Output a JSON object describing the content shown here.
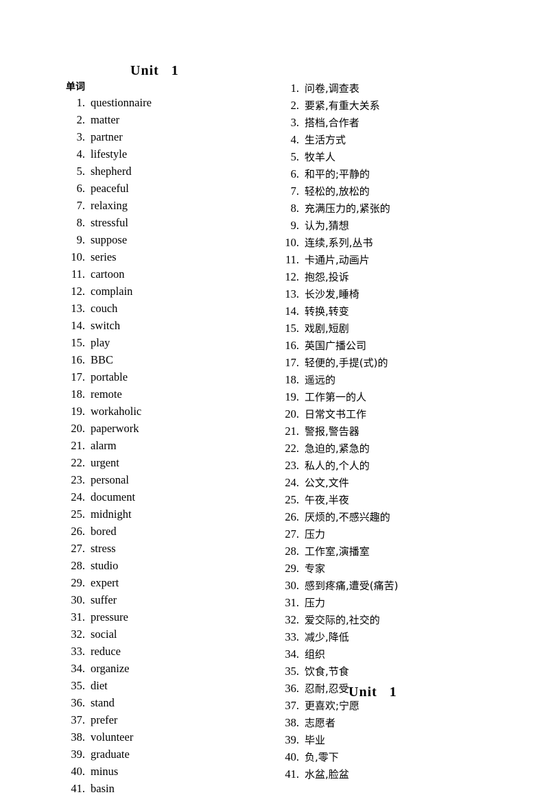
{
  "document": {
    "title_word": "Unit",
    "title_number": "1",
    "section_label": "单词",
    "footer_word": "Unit",
    "footer_number": "1"
  },
  "english_words": [
    {
      "idx": "1.",
      "text": "questionnaire"
    },
    {
      "idx": "2.",
      "text": "matter"
    },
    {
      "idx": "3.",
      "text": "partner"
    },
    {
      "idx": "4.",
      "text": "lifestyle"
    },
    {
      "idx": "5.",
      "text": "shepherd"
    },
    {
      "idx": "6.",
      "text": "peaceful"
    },
    {
      "idx": "7.",
      "text": "relaxing"
    },
    {
      "idx": "8.",
      "text": "stressful"
    },
    {
      "idx": "9.",
      "text": "suppose"
    },
    {
      "idx": "10.",
      "text": "series"
    },
    {
      "idx": "11.",
      "text": "cartoon"
    },
    {
      "idx": "12.",
      "text": "complain"
    },
    {
      "idx": "13.",
      "text": "couch"
    },
    {
      "idx": "14.",
      "text": "switch"
    },
    {
      "idx": "15.",
      "text": "play"
    },
    {
      "idx": "16.",
      "text": "BBC"
    },
    {
      "idx": "17.",
      "text": "portable"
    },
    {
      "idx": "18.",
      "text": "remote"
    },
    {
      "idx": "19.",
      "text": "workaholic"
    },
    {
      "idx": "20.",
      "text": "paperwork"
    },
    {
      "idx": "21.",
      "text": "alarm"
    },
    {
      "idx": "22.",
      "text": "urgent"
    },
    {
      "idx": "23.",
      "text": "personal"
    },
    {
      "idx": "24.",
      "text": "document"
    },
    {
      "idx": "25.",
      "text": "midnight"
    },
    {
      "idx": "26.",
      "text": "bored"
    },
    {
      "idx": "27.",
      "text": "stress"
    },
    {
      "idx": "28.",
      "text": "studio"
    },
    {
      "idx": "29.",
      "text": "expert"
    },
    {
      "idx": "30.",
      "text": "suffer"
    },
    {
      "idx": "31.",
      "text": "pressure"
    },
    {
      "idx": "32.",
      "text": "social"
    },
    {
      "idx": "33.",
      "text": "reduce"
    },
    {
      "idx": "34.",
      "text": "organize"
    },
    {
      "idx": "35.",
      "text": "diet"
    },
    {
      "idx": "36.",
      "text": "stand"
    },
    {
      "idx": "37.",
      "text": "prefer"
    },
    {
      "idx": "38.",
      "text": "volunteer"
    },
    {
      "idx": "39.",
      "text": "graduate"
    },
    {
      "idx": "40.",
      "text": "minus"
    },
    {
      "idx": "41.",
      "text": "basin"
    }
  ],
  "chinese_meanings": [
    {
      "idx": "1.",
      "text": "问卷,调查表"
    },
    {
      "idx": "2.",
      "text": "要紧,有重大关系"
    },
    {
      "idx": "3.",
      "text": "搭档,合作者"
    },
    {
      "idx": "4.",
      "text": "生活方式"
    },
    {
      "idx": "5.",
      "text": "牧羊人"
    },
    {
      "idx": "6.",
      "text": "和平的;平静的"
    },
    {
      "idx": "7.",
      "text": "轻松的,放松的"
    },
    {
      "idx": "8.",
      "text": "充满压力的,紧张的"
    },
    {
      "idx": "9.",
      "text": "认为,猜想"
    },
    {
      "idx": "10.",
      "text": "连续,系列,丛书"
    },
    {
      "idx": "11.",
      "text": "卡通片,动画片"
    },
    {
      "idx": "12.",
      "text": "抱怨,投诉"
    },
    {
      "idx": "13.",
      "text": "长沙发,睡椅"
    },
    {
      "idx": "14.",
      "text": "转换,转变"
    },
    {
      "idx": "15.",
      "text": "戏剧,短剧"
    },
    {
      "idx": "16.",
      "text": "英国广播公司"
    },
    {
      "idx": "17.",
      "text": "轻便的,手提(式)的"
    },
    {
      "idx": "18.",
      "text": "遥远的"
    },
    {
      "idx": "19.",
      "text": "工作第一的人"
    },
    {
      "idx": "20.",
      "text": "日常文书工作"
    },
    {
      "idx": "21.",
      "text": "警报,警告器"
    },
    {
      "idx": "22.",
      "text": "急迫的,紧急的"
    },
    {
      "idx": "23.",
      "text": "私人的,个人的"
    },
    {
      "idx": "24.",
      "text": "公文,文件"
    },
    {
      "idx": "25.",
      "text": "午夜,半夜"
    },
    {
      "idx": "26.",
      "text": "厌烦的,不感兴趣的"
    },
    {
      "idx": "27.",
      "text": "压力"
    },
    {
      "idx": "28.",
      "text": "工作室,演播室"
    },
    {
      "idx": "29.",
      "text": "专家"
    },
    {
      "idx": "30.",
      "text": "感到疼痛,遭受(痛苦)"
    },
    {
      "idx": "31.",
      "text": "压力"
    },
    {
      "idx": "32.",
      "text": "爱交际的,社交的"
    },
    {
      "idx": "33.",
      "text": "减少,降低"
    },
    {
      "idx": "34.",
      "text": "组织"
    },
    {
      "idx": "35.",
      "text": "饮食,节食"
    },
    {
      "idx": "36.",
      "text": "忍耐,忍受"
    },
    {
      "idx": "37.",
      "text": "更喜欢;宁愿"
    },
    {
      "idx": "38.",
      "text": "志愿者"
    },
    {
      "idx": "39.",
      "text": "毕业"
    },
    {
      "idx": "40.",
      "text": "负,零下"
    },
    {
      "idx": "41.",
      "text": "水盆,脸盆"
    }
  ]
}
